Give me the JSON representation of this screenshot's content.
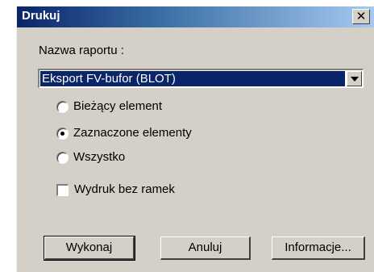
{
  "window": {
    "title": "Drukuj",
    "close_glyph": "✕"
  },
  "report": {
    "label": "Nazwa raportu :",
    "selected": "Eksport FV-bufor (BLOT)"
  },
  "scope_options": [
    {
      "label": "Bieżący element",
      "checked": false
    },
    {
      "label": "Zaznaczone elementy",
      "checked": true
    },
    {
      "label": "Wszystko",
      "checked": false
    }
  ],
  "no_frames": {
    "label": "Wydruk bez ramek",
    "checked": false
  },
  "buttons": {
    "run": "Wykonaj",
    "cancel": "Anuluj",
    "info": "Informacje..."
  },
  "icons": {
    "close": "close-icon",
    "dropdown": "chevron-down-icon"
  },
  "colors": {
    "titlebar_start": "#0a246a",
    "titlebar_end": "#a6caf0",
    "dialog_bg": "#d4d0c8",
    "selection_bg": "#0a246a"
  }
}
